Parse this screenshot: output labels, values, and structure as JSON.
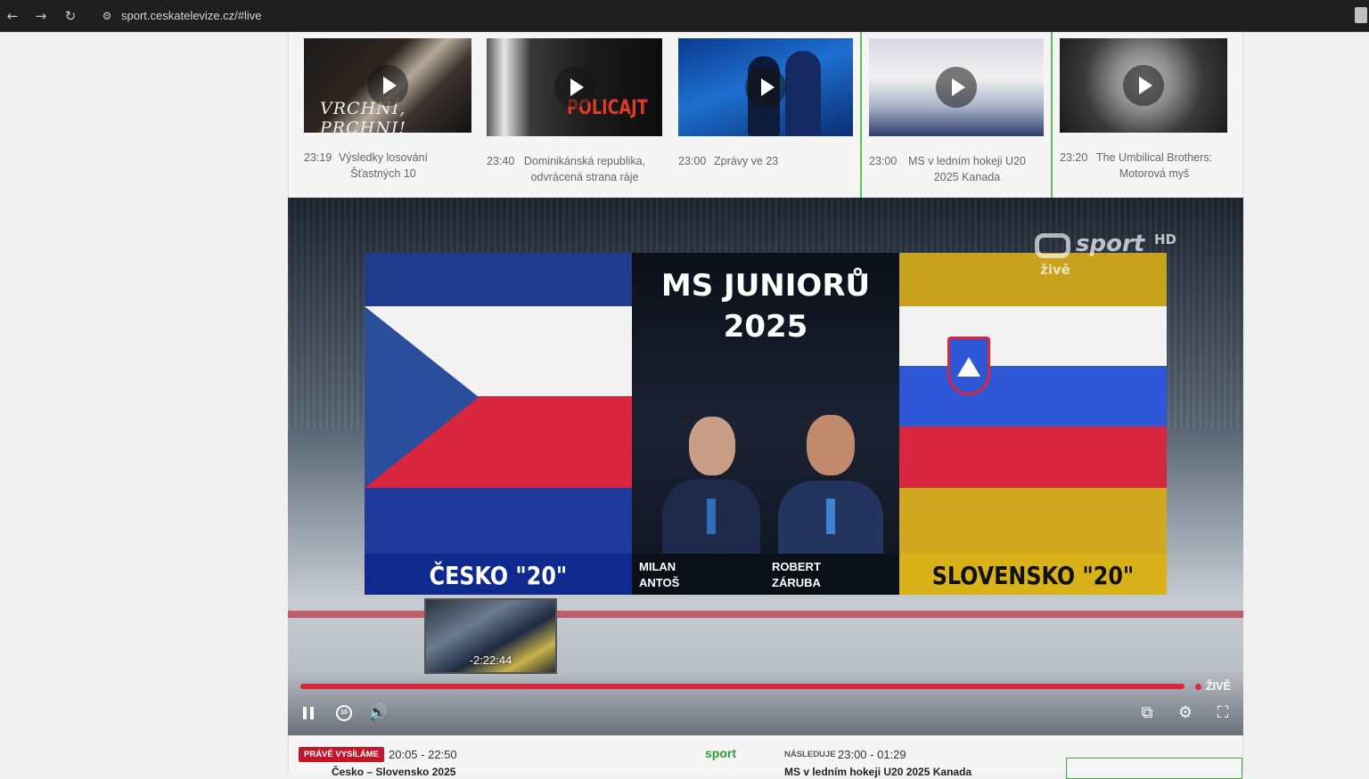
{
  "browser": {
    "url": "sport.ceskatelevize.cz/#live",
    "back_icon": "←",
    "forward_icon": "→",
    "reload_icon": "↻",
    "site_icon": "⚙"
  },
  "carousel": {
    "items": [
      {
        "time": "23:19",
        "title": "Výsledky losování Šťastných 10",
        "thumb_text": "VRCHNÍ, PRCHNI!"
      },
      {
        "time": "23:40",
        "title": "Dominikánská republika, odvrácená strana ráje",
        "thumb_text": "POLICAJT"
      },
      {
        "time": "23:00",
        "title": "Zprávy ve 23",
        "thumb_text": ""
      },
      {
        "time": "23:00",
        "title": "MS v ledním hokeji U20 2025 Kanada",
        "thumb_text": ""
      },
      {
        "time": "23:20",
        "title": "The Umbilical Brothers: Motorová myš",
        "thumb_text": ""
      }
    ]
  },
  "player": {
    "title_line1": "MS JUNIORŮ",
    "title_line2": "2025",
    "team_left": "ČESKO \"20\"",
    "team_right": "SLOVENSKO \"20\"",
    "commentator1_first": "MILAN",
    "commentator1_last": "ANTOŠ",
    "commentator2_first": "ROBERT",
    "commentator2_last": "ZÁRUBA",
    "logo_sport": "sport",
    "logo_hd": "HD",
    "logo_live": "živě",
    "preview_time": "-2:22:44",
    "live_label": "ŽIVĚ",
    "progress_fraction": 1.0,
    "colors": {
      "accent_red": "#d9263b"
    }
  },
  "controls": {
    "pause_icon": "pause-icon",
    "replay_label": "10",
    "volume_icon": "🔊",
    "cast_icon": "⧉",
    "settings_icon": "⚙",
    "fullscreen_icon": "⛶"
  },
  "strip": {
    "now_badge": "PRÁVĚ VYSÍLÁME",
    "now_time": "20:05 - 22:50",
    "now_title": "Česko – Slovensko 2025",
    "channel": "sport",
    "next_label": "NÁSLEDUJE",
    "next_time": "23:00 - 01:29",
    "next_title": "MS v ledním hokeji U20 2025 Kanada"
  }
}
